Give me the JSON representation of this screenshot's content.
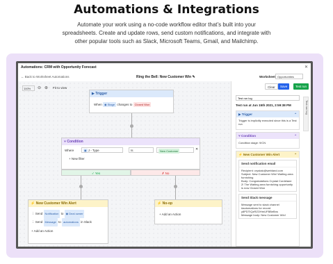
{
  "heading": "Automations & Integrations",
  "description_lines": [
    "Automate your work using a no-code workflow editor that’s built into your",
    "spreadsheets. Create and update rows, send custom notifications, and integrate with",
    "other popular tools such as Slack, Microsoft Teams, Gmail, and Mailchimp."
  ],
  "window": {
    "title": "Automations: CRM with Opportunity Forecast",
    "back_link": "Back to Worksheet Automations",
    "workflow_name": "Ring the Bell: New Customer Win",
    "worksheet_label": "Worksheet",
    "worksheet_value": "Opportunities",
    "clear_label": "Clear",
    "save_label": "Save",
    "test_run_label": "Test run"
  },
  "toolbar": {
    "zoom": "100%",
    "fit_view": "Fit to view"
  },
  "trigger": {
    "title": "Trigger",
    "when": "When",
    "field": "Stage",
    "changes_to": "changes to",
    "value": "Closed Won"
  },
  "condition": {
    "title": "Condition",
    "where": "Where",
    "field": "J - Type",
    "operator": "Is",
    "value": "New Customer",
    "new_filter": "New filter",
    "yes": "Yes",
    "no": "No"
  },
  "alert": {
    "title": "New Customer Win Alert",
    "send": "Send",
    "item1": "Notification",
    "to": "to",
    "recipient1": "Deal owner",
    "item2": "Message",
    "recipient2": "automations",
    "in_slack": "in Slack",
    "add_action": "Add an Action"
  },
  "noop": {
    "title": "No-op",
    "add_action": "Add an Action"
  },
  "test_log": {
    "tab_label": "Test run log",
    "header": "Test run at Jun 15th 2021, 2:59:38 PM",
    "trigger_title": "Trigger",
    "trigger_text": "Trigger is implicitly executed since this is a Test run",
    "condition_title": "Condition",
    "condition_text": "Condition stage: 9/CN",
    "alert_title": "New Customer Win Alert",
    "email_title": "Send notification email",
    "email_recipient": "Recipient: crystalc@webland.com",
    "email_subject": "Subject: New Customer Win! Waiting area furnishing",
    "email_body": "Body: Congratulations Crystal Cordelane 2! The Waiting area furnishing opportunity is now Closed Won",
    "slack_title": "Send Slack message",
    "slack_text1": "Message sent to slack channel #automations for record y8PDTIQzRZOHmUFBBeBns",
    "slack_text2": "Message body: New Customer Win!"
  },
  "side_tab": "Test run log",
  "colors": {
    "purple_bg": "#ece0f8",
    "blue": "#2563eb",
    "green": "#16a34a"
  }
}
